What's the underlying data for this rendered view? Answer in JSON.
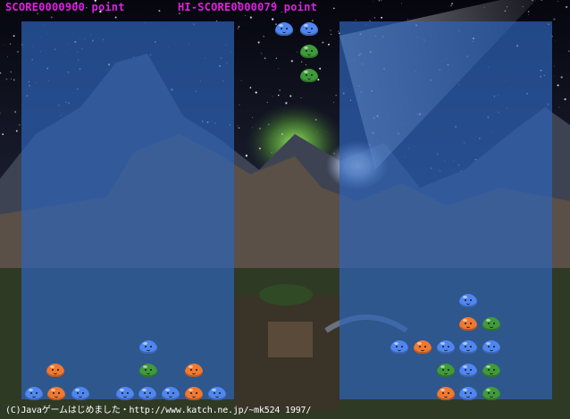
{
  "hud": {
    "score_text": "SCORE0000900 point",
    "hiscore_text": "HI-SCORE0000079 point"
  },
  "footer": {
    "credit": "(C)Javaゲームはじめました・http://www.katch.ne.jp/~mk524 1997/"
  },
  "colors": {
    "hud_text": "#e020e0",
    "well_overlay": "#2d64b9",
    "blob_blue": "#4f86f0",
    "blob_orange": "#f07830",
    "blob_green": "#3f9a3a"
  },
  "falling_piece": [
    "blue",
    "blue",
    "green",
    "green"
  ],
  "left_well_blobs": [
    "blue",
    "orange",
    "green",
    "orange",
    "blue",
    "orange",
    "blue",
    "blue",
    "blue",
    "blue",
    "orange",
    "blue"
  ],
  "right_well_blobs": [
    "blue",
    "orange",
    "green",
    "blue",
    "orange",
    "blue",
    "blue",
    "blue",
    "green",
    "blue",
    "green",
    "orange",
    "blue",
    "green"
  ]
}
